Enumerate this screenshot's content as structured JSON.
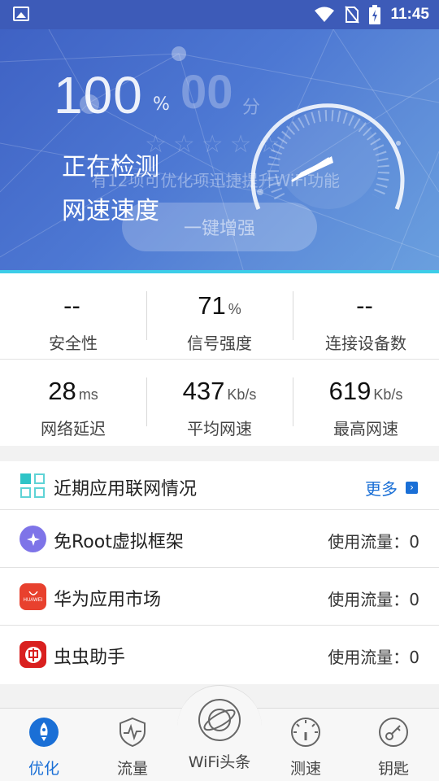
{
  "status_bar": {
    "time": "11:45"
  },
  "hero": {
    "score": "100",
    "score_unit": "%",
    "ghost_score": "00",
    "ghost_unit": "分",
    "stars": "☆☆☆☆☆",
    "status_line1": "正在检测",
    "status_line2": "网速速度",
    "hint": "有12项可优化项迅捷提升WiFi功能",
    "boost_button": "一键增强"
  },
  "stats": [
    {
      "value": "--",
      "unit": "",
      "label": "安全性"
    },
    {
      "value": "71",
      "unit": "%",
      "label": "信号强度"
    },
    {
      "value": "--",
      "unit": "",
      "label": "连接设备数"
    },
    {
      "value": "28",
      "unit": "ms",
      "label": "网络延迟"
    },
    {
      "value": "437",
      "unit": "Kb/s",
      "label": "平均网速"
    },
    {
      "value": "619",
      "unit": "Kb/s",
      "label": "最高网速"
    }
  ],
  "apps_section": {
    "title": "近期应用联网情况",
    "more": "更多",
    "items": [
      {
        "name": "免Root虚拟框架",
        "usage": "使用流量：0",
        "icon": "plus-circle-icon",
        "color": "#7e74e8"
      },
      {
        "name": "华为应用市场",
        "usage": "使用流量：0",
        "icon": "huawei-bag-icon",
        "color": "#e8412e",
        "icon_text": "HUAWEI"
      },
      {
        "name": "虫虫助手",
        "usage": "使用流量：0",
        "icon": "chongchong-icon",
        "color": "#d9201f"
      }
    ]
  },
  "nav": [
    {
      "label": "优化",
      "icon": "rocket-icon",
      "active": true
    },
    {
      "label": "流量",
      "icon": "pulse-shield-icon",
      "active": false
    },
    {
      "label": "WiFi头条",
      "icon": "planet-icon",
      "active": false
    },
    {
      "label": "测速",
      "icon": "speedometer-icon",
      "active": false
    },
    {
      "label": "钥匙",
      "icon": "key-icon",
      "active": false
    }
  ],
  "colors": {
    "accent": "#1a6fd6",
    "hero": "#4a70cf",
    "cyan_line": "#3ccde8"
  }
}
